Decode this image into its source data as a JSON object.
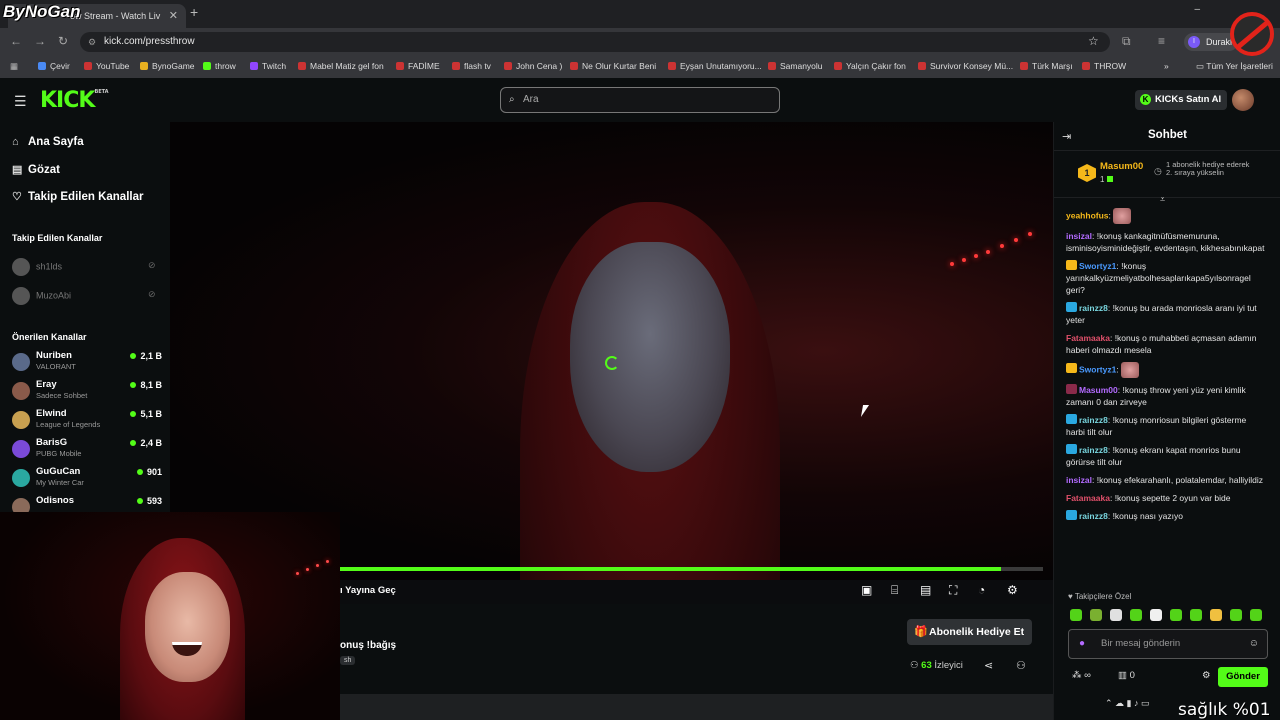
{
  "browser": {
    "tab_title": "ow Stream - Watch Liv",
    "url": "kick.com/pressthrow",
    "profile_label": "Durakl",
    "profile_initial": "I",
    "bookmarks": [
      "Çevir",
      "YouTube",
      "BynoGame",
      "throw",
      "Twitch",
      "Mabel Matiz  gel fon",
      "FADİME",
      "flash tv",
      "John Cena )",
      "Ne Olur Kurtar Beni",
      "Eyşan Unutamıyoru...",
      "Samanyolu",
      "Yalçın Çakır  fon",
      "Survivor Konsey Mü...",
      "Türk Marşı",
      "THROW"
    ],
    "bookmarks_more": "»",
    "all_bookmarks": "Tüm Yer İşaretleri"
  },
  "overlay": {
    "bynogan": "ByNoGan",
    "saglik": "sağlık %01"
  },
  "kick": {
    "logo": "KICK",
    "logo_beta": "BETA",
    "search_placeholder": "Ara",
    "kicks_button": "KICKs Satın Al"
  },
  "sidebar": {
    "nav": [
      {
        "icon": "home-icon",
        "label": "Ana Sayfa"
      },
      {
        "icon": "browse-icon",
        "label": "Gözat"
      },
      {
        "icon": "heart-icon",
        "label": "Takip Edilen Kanallar"
      }
    ],
    "followed_heading": "Takip Edilen Kanallar",
    "followed": [
      "sh1lds",
      "MuzoAbi"
    ],
    "recommended_heading": "Önerilen Kanallar",
    "recommended": [
      {
        "name": "Nuriben",
        "game": "VALORANT",
        "viewers": "2,1 B",
        "color": "#5a6a8a"
      },
      {
        "name": "Eray",
        "game": "Sadece Sohbet",
        "viewers": "8,1 B",
        "color": "#8a5a4a"
      },
      {
        "name": "Elwind",
        "game": "League of Legends",
        "viewers": "5,1 B",
        "color": "#c8a050"
      },
      {
        "name": "BarisG",
        "game": "PUBG Mobile",
        "viewers": "2,4 B",
        "color": "#7a4ad8"
      },
      {
        "name": "GuGuCan",
        "game": "My Winter Car",
        "viewers": "901",
        "color": "#2aa8a0"
      },
      {
        "name": "Odisnos",
        "game": "",
        "viewers": "593",
        "color": "#8a6a5a"
      }
    ]
  },
  "player": {
    "progress": 0.94,
    "live_label": "ı Yayına Geç",
    "controls": [
      "miniplayer-icon",
      "theater-icon",
      "pip-icon",
      "fullscreen-icon",
      "clip-icon",
      "settings-icon"
    ]
  },
  "stream": {
    "title": "onuş !bağış",
    "tag": "sh",
    "gift_button": "Abonelik Hediye Et",
    "viewer_count": "63",
    "viewer_label": "İzleyici"
  },
  "chat": {
    "title": "Sohbet",
    "pinned": {
      "rank": "1",
      "user": "Masum00",
      "count": "1",
      "text": "1 abonelik hediye ederek 2. sıraya yükselin"
    },
    "messages": [
      {
        "user": "yeahhofus",
        "color": "#f5b81a",
        "badge": "",
        "text": "",
        "emote": true
      },
      {
        "user": "insizal",
        "color": "#b36bff",
        "badge": "",
        "text": "!konuş kankagitnüfüsmemuruna, isminisoyisminideğiştir, evdentaşın, kikhesabınıkapat",
        "emote": false
      },
      {
        "user": "Swortyz1",
        "color": "#4a9aff",
        "badge": "#f5b81a",
        "text": "!konuş yarınkalkyüzmeliyatbolhesaplarıkapa5yılsonragel geri?",
        "emote": false
      },
      {
        "user": "rainzz8",
        "color": "#7ad7e0",
        "badge": "#2aa8e0",
        "text": "!konuş bu arada monriosla aranı iyi tut yeter",
        "emote": false
      },
      {
        "user": "Fatamaaka",
        "color": "#e0506a",
        "badge": "",
        "text": "!konuş o muhabbeti açmasan adamın haberi olmazdı mesela",
        "emote": false
      },
      {
        "user": "Swortyz1",
        "color": "#4a9aff",
        "badge": "#f5b81a",
        "text": "",
        "emote": true
      },
      {
        "user": "Masum00",
        "color": "#b36bff",
        "badge": "#8a2a4a",
        "text": "!konuş throw yeni yüz yeni kimlik zamanı 0 dan zirveye",
        "emote": false
      },
      {
        "user": "rainzz8",
        "color": "#7ad7e0",
        "badge": "#2aa8e0",
        "text": "!konuş monriosun bilgileri gösterme harbi tilt olur",
        "emote": false
      },
      {
        "user": "rainzz8",
        "color": "#7ad7e0",
        "badge": "#2aa8e0",
        "text": "!konuş ekranı kapat monrios bunu görürse tilt olur",
        "emote": false
      },
      {
        "user": "insizal",
        "color": "#b36bff",
        "badge": "",
        "text": "!konuş efekarahanlı, polatalemdar, halliyildiz",
        "emote": false
      },
      {
        "user": "Fatamaaka",
        "color": "#e0506a",
        "badge": "",
        "text": "!konuş sepette 2 oyun var bide",
        "emote": false
      },
      {
        "user": "rainzz8",
        "color": "#7ad7e0",
        "badge": "#2aa8e0",
        "text": "!konuş nası yazıyo",
        "emote": false
      }
    ],
    "followers_only": "Takipçilere Özel",
    "input_placeholder": "Bir mesaj gönderin",
    "infinity": "∞",
    "chest_count": "0",
    "send_button": "Gönder"
  }
}
